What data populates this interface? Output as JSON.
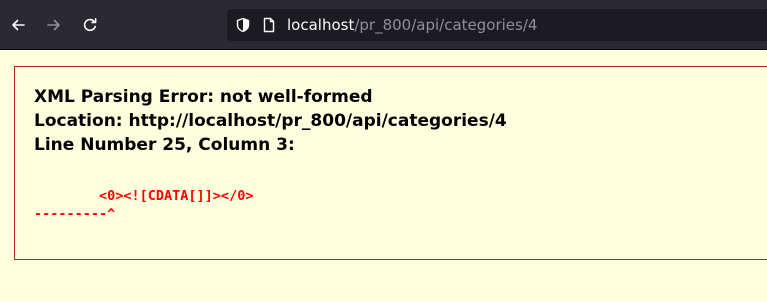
{
  "browser": {
    "address_host": "localhost",
    "address_path": "/pr_800/api/categories/4"
  },
  "error": {
    "title": "XML Parsing Error: not well-formed",
    "location": "Location: http://localhost/pr_800/api/categories/4",
    "line_info": "Line Number 25, Column 3:",
    "source_line": "        <0><![CDATA[]]></0>",
    "pointer_line": "---------^"
  },
  "colors": {
    "page_background": "#ffffe0",
    "border": "#b22222",
    "source_text": "#ff0000",
    "toolbar": "#2b2a33",
    "urlbar": "#1c1b22"
  }
}
